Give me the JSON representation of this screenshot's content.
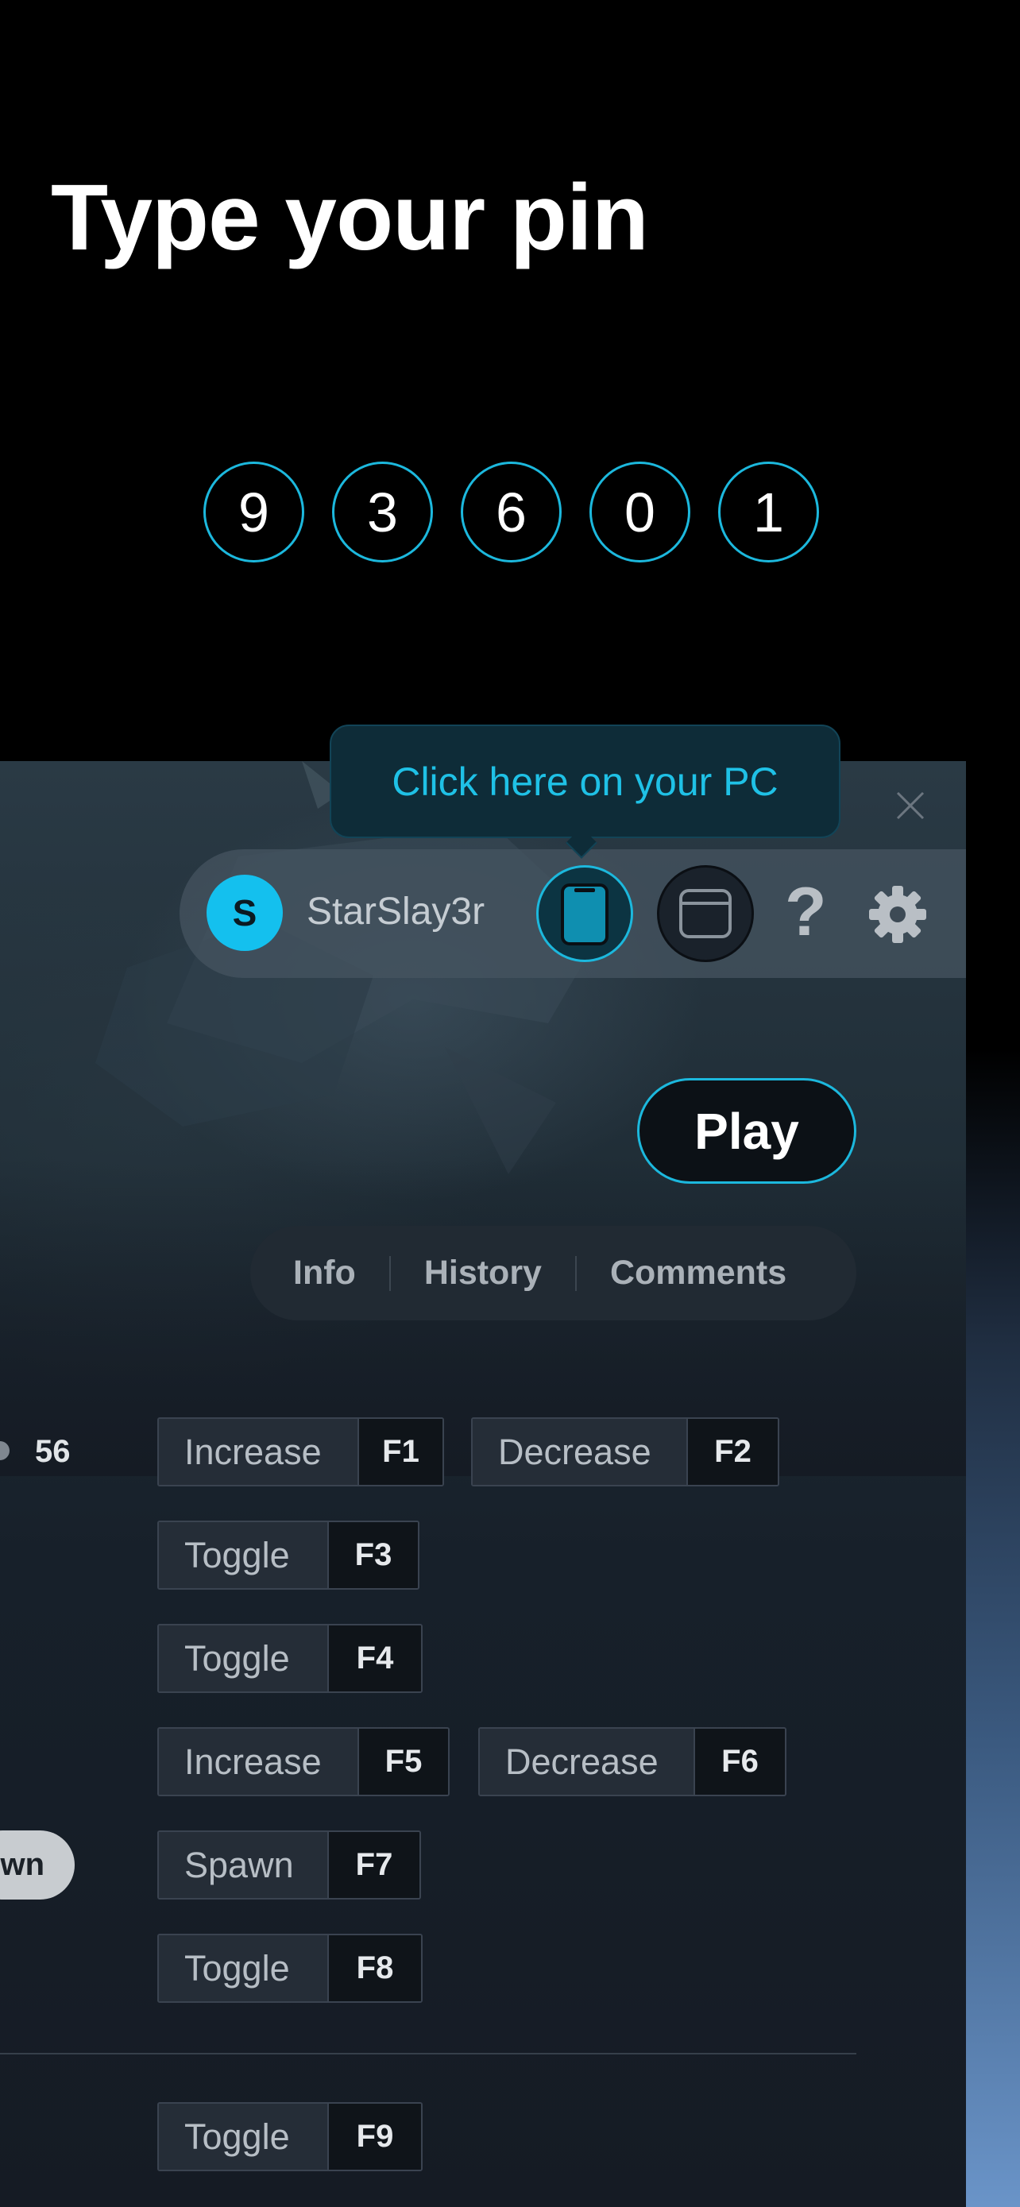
{
  "header": {
    "title": "Type your pin"
  },
  "pin": {
    "digits": [
      "9",
      "3",
      "6",
      "0",
      "1"
    ]
  },
  "tooltip": {
    "text": "Click here on your PC"
  },
  "user": {
    "avatar_initial": "S",
    "name": "StarSlay3r",
    "help_label": "?"
  },
  "colors": {
    "accent": "#1cb8dd",
    "avatar": "#14c0ee",
    "tooltip_text": "#1fc1e6"
  },
  "play": {
    "label": "Play"
  },
  "tabs": [
    {
      "label": "Info"
    },
    {
      "label": "History"
    },
    {
      "label": "Comments"
    }
  ],
  "slider": {
    "value": "56"
  },
  "partial_button": {
    "label": "wn"
  },
  "controls": [
    {
      "label": "Increase",
      "key": "F1"
    },
    {
      "label": "Decrease",
      "key": "F2"
    },
    {
      "label": "Toggle",
      "key": "F3"
    },
    {
      "label": "Toggle",
      "key": "F4"
    },
    {
      "label": "Increase",
      "key": "F5"
    },
    {
      "label": "Decrease",
      "key": "F6"
    },
    {
      "label": "Spawn",
      "key": "F7"
    },
    {
      "label": "Toggle",
      "key": "F8"
    },
    {
      "label": "Toggle",
      "key": "F9"
    }
  ]
}
